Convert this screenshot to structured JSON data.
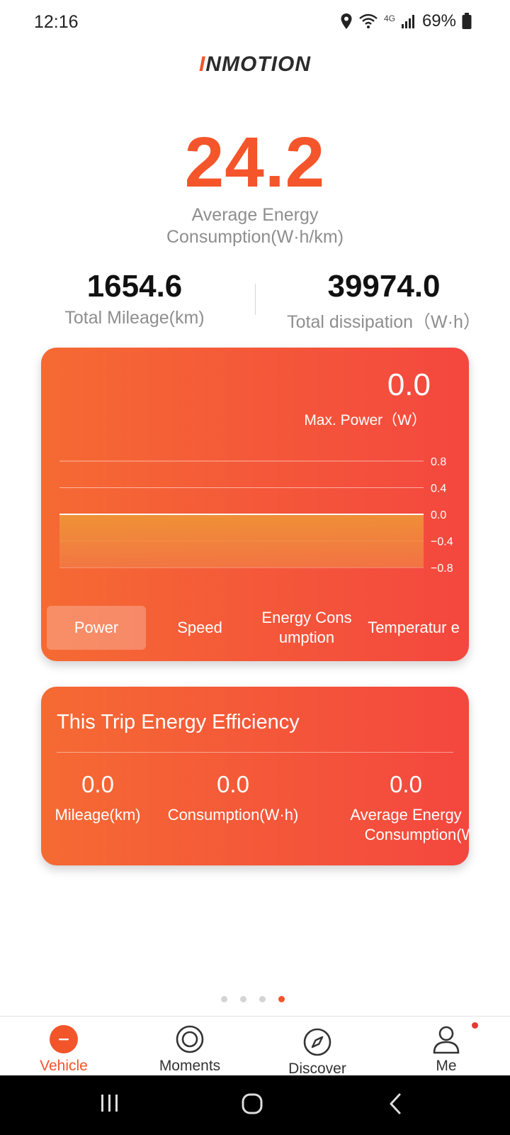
{
  "status_bar": {
    "time": "12:16",
    "battery": "69%",
    "network": "4G"
  },
  "brand": {
    "logo_prefix": "I",
    "logo_rest": "NMOTION"
  },
  "summary": {
    "avg_energy_value": "24.2",
    "avg_energy_label": "Average Energy Consumption(W·h/km)",
    "total_mileage_value": "1654.6",
    "total_mileage_label": "Total Mileage(km)",
    "total_dissipation_value": "39974.0",
    "total_dissipation_label": "Total dissipation（W·h）"
  },
  "power_card": {
    "max_power_value": "0.0",
    "max_power_label": "Max. Power（W）",
    "tabs": {
      "power": "Power",
      "speed": "Speed",
      "energy": "Energy Cons umption",
      "temperature": "Temperatur e"
    },
    "active_tab": "power"
  },
  "chart_data": {
    "type": "area",
    "y_ticks": [
      "0.8",
      "0.4",
      "0.0",
      "−0.4",
      "−0.8"
    ],
    "ylim": [
      -0.8,
      0.8
    ],
    "values": [
      0,
      0
    ],
    "grid": true,
    "colors": {
      "fill_top": "#ee9a36",
      "fill_bottom": "#f27945",
      "line": "#ffffff"
    }
  },
  "trip_card": {
    "title": "This Trip Energy Efficiency",
    "mileage_value": "0.0",
    "mileage_label": "Mileage(km)",
    "consumption_value": "0.0",
    "consumption_label": "Consumption(W·h)",
    "avg_value": "0.0",
    "avg_label_1": "Average Energy",
    "avg_label_2": "Consumption(W·h/"
  },
  "pager": {
    "count": 4,
    "active_index": 3
  },
  "bottom_nav": {
    "vehicle": "Vehicle",
    "moments": "Moments",
    "discover": "Discover",
    "me": "Me"
  },
  "colors": {
    "accent": "#f2552a",
    "card_start": "#f56a33",
    "card_end": "#f4473f"
  }
}
